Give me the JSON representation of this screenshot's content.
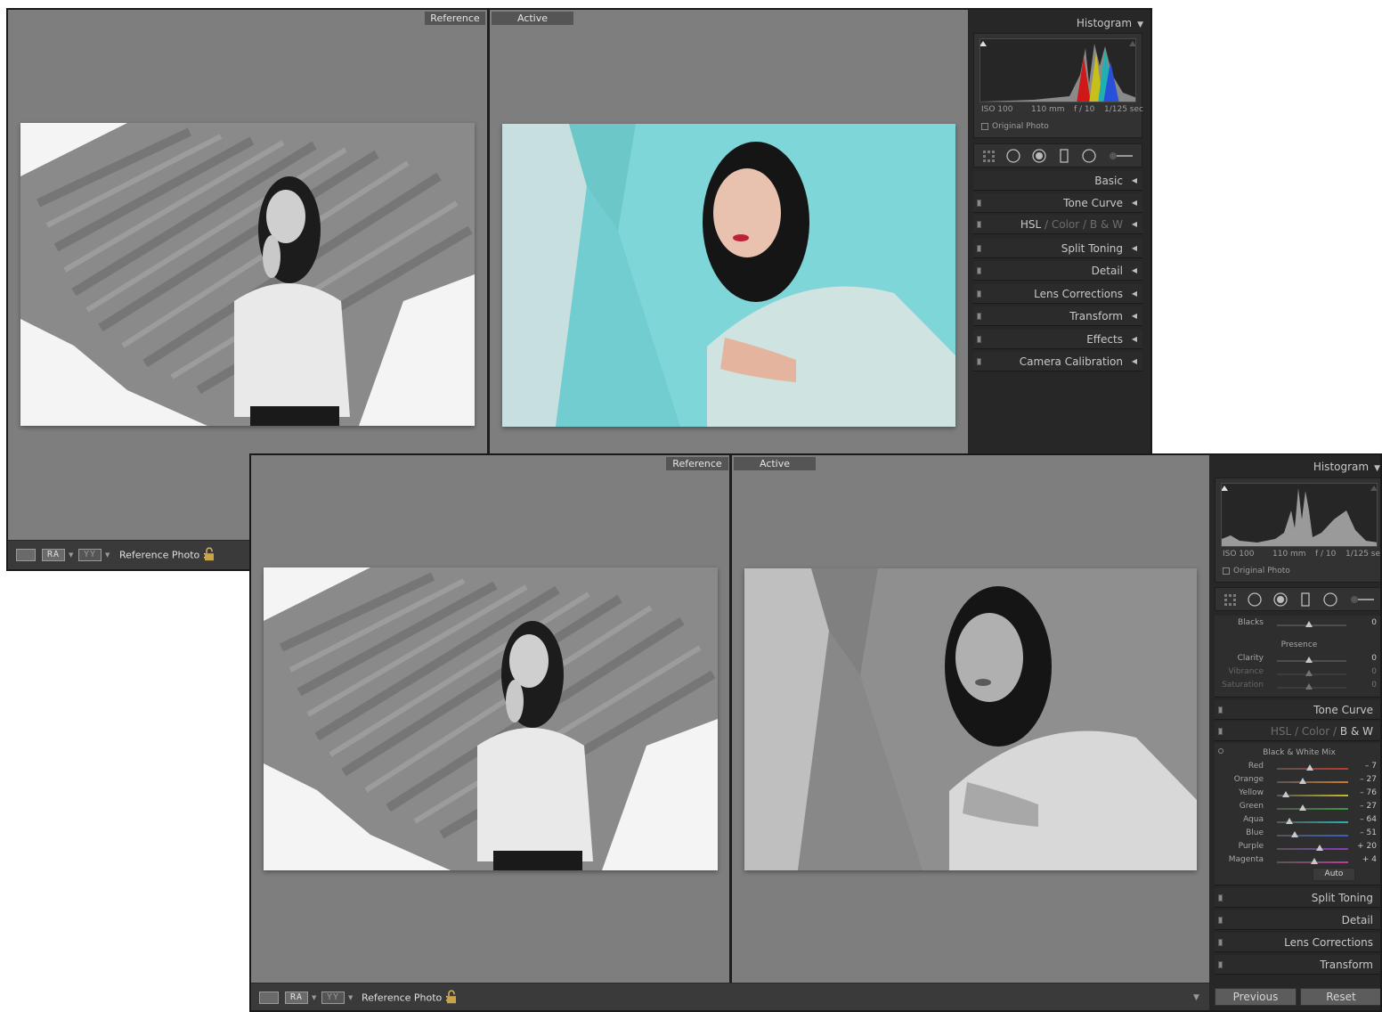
{
  "window1": {
    "reference_label": "Reference",
    "active_label": "Active",
    "toolbar": {
      "compare_icon": "RA",
      "swap_icon": "YY",
      "reference_photo_label": "Reference Photo :"
    },
    "panel": {
      "histogram_title": "Histogram",
      "exif": {
        "iso": "ISO 100",
        "focal": "110 mm",
        "aperture": "f / 10",
        "shutter": "1/125 sec"
      },
      "original_photo": "Original Photo",
      "sections": [
        "Basic",
        "Tone Curve",
        "Split Toning",
        "Detail",
        "Lens Corrections",
        "Transform",
        "Effects",
        "Camera Calibration"
      ],
      "hsl": {
        "hsl": "HSL",
        "sep1": "/",
        "color": "Color",
        "sep2": "/",
        "bw": "B & W"
      }
    }
  },
  "window2": {
    "reference_label": "Reference",
    "active_label": "Active",
    "toolbar": {
      "compare_icon": "RA",
      "swap_icon": "YY",
      "reference_photo_label": "Reference Photo :"
    },
    "panel": {
      "histogram_title": "Histogram",
      "exif": {
        "iso": "ISO 100",
        "focal": "110 mm",
        "aperture": "f / 10",
        "shutter": "1/125 sec"
      },
      "original_photo": "Original Photo",
      "blacks": {
        "label": "Blacks",
        "value": "0"
      },
      "presence": {
        "title": "Presence",
        "sliders": [
          {
            "label": "Clarity",
            "value": "0"
          },
          {
            "label": "Vibrance",
            "value": "0"
          },
          {
            "label": "Saturation",
            "value": "0"
          }
        ]
      },
      "tone_curve": "Tone Curve",
      "hsl": {
        "hsl": "HSL",
        "sep1": "/",
        "color": "Color",
        "sep2": "/",
        "bw": "B & W"
      },
      "bw_mix": {
        "title": "Black & White Mix",
        "sliders": [
          {
            "label": "Red",
            "value": "– 7",
            "level": -7,
            "color": "#c0392b"
          },
          {
            "label": "Orange",
            "value": "– 27",
            "level": -27,
            "color": "#d2782a"
          },
          {
            "label": "Yellow",
            "value": "– 76",
            "level": -76,
            "color": "#c8b92a"
          },
          {
            "label": "Green",
            "value": "– 27",
            "level": -27,
            "color": "#3a9a3a"
          },
          {
            "label": "Aqua",
            "value": "– 64",
            "level": -64,
            "color": "#2ab0b0"
          },
          {
            "label": "Blue",
            "value": "– 51",
            "level": -51,
            "color": "#3a5fc0"
          },
          {
            "label": "Purple",
            "value": "+ 20",
            "level": 20,
            "color": "#8a3ac0"
          },
          {
            "label": "Magenta",
            "value": "+ 4",
            "level": 4,
            "color": "#c03a9a"
          }
        ],
        "auto": "Auto"
      },
      "sections": [
        "Split Toning",
        "Detail",
        "Lens Corrections",
        "Transform"
      ],
      "previous": "Previous",
      "reset": "Reset"
    }
  }
}
